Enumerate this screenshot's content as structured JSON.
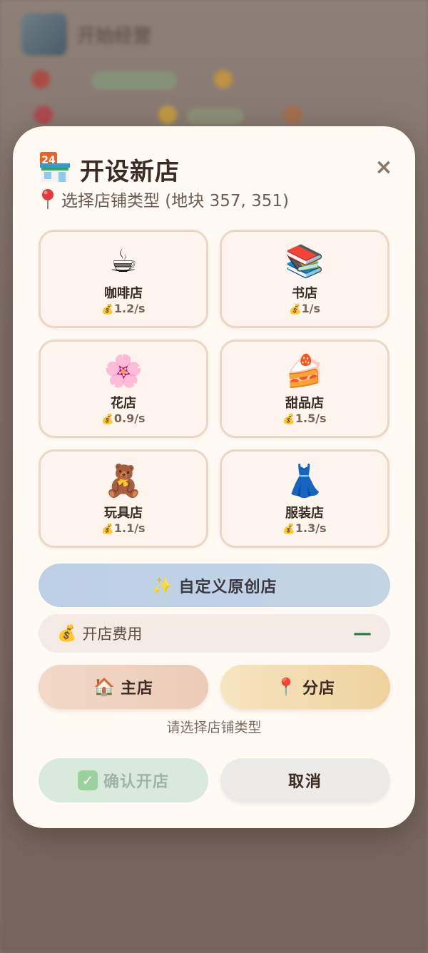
{
  "background": {
    "title": "开始经营"
  },
  "modal": {
    "title_icon": "convenience-store-icon",
    "title": "开设新店",
    "close_label": "×",
    "subtitle_icon": "pin-icon",
    "subtitle": "选择店铺类型 (地块 357, 351)",
    "shops": [
      {
        "emoji": "☕",
        "icon": "coffee-icon",
        "name": "咖啡店",
        "rate": "1.2/s"
      },
      {
        "emoji": "📚",
        "icon": "books-icon",
        "name": "书店",
        "rate": "1/s"
      },
      {
        "emoji": "🌸",
        "icon": "cherry-blossom-icon",
        "name": "花店",
        "rate": "0.9/s"
      },
      {
        "emoji": "🍰",
        "icon": "cake-icon",
        "name": "甜品店",
        "rate": "1.5/s"
      },
      {
        "emoji": "🧸",
        "icon": "teddy-bear-icon",
        "name": "玩具店",
        "rate": "1.1/s"
      },
      {
        "emoji": "👗",
        "icon": "dress-icon",
        "name": "服装店",
        "rate": "1.3/s"
      }
    ],
    "custom_button": {
      "icon": "✨",
      "label": "自定义原创店"
    },
    "cost": {
      "icon": "💰",
      "label": "开店费用",
      "value": "—"
    },
    "main_store": {
      "icon": "🏠",
      "label": "主店"
    },
    "branch_store": {
      "icon": "📍",
      "label": "分店"
    },
    "hint": "请选择店铺类型",
    "confirm": {
      "icon": "✓",
      "label": "确认开店"
    },
    "cancel": {
      "label": "取消"
    },
    "coin_icon": "💰",
    "colors": {
      "accent_green": "#2d7a4c",
      "card_border": "#ead8c4",
      "modal_bg": "#fffaf4"
    }
  }
}
